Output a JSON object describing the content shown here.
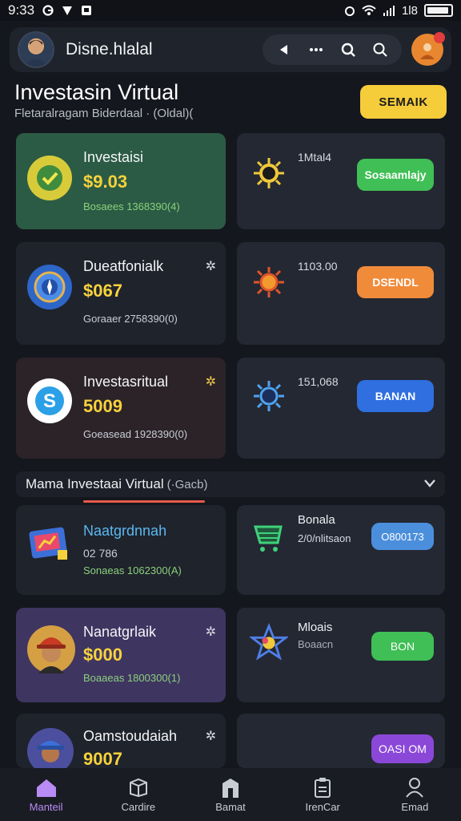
{
  "status": {
    "time": "9:33",
    "right_text": "1l8"
  },
  "appbar": {
    "title": "Disne.hlalal"
  },
  "page": {
    "title": "Investasin Virtual",
    "subtitle": "Fletaralragam Biderdaal · (Oldal)(",
    "button": "SEMAIK"
  },
  "cards": [
    {
      "title": "Investaisi",
      "value": "$9.03",
      "sub": "Bosaees 1368390(4)"
    },
    {
      "label": "1Mtal4",
      "button": "Sosaamlajy"
    },
    {
      "title": "Dueatfonialk",
      "value": "$067",
      "sub": "Goraaer 2758390(0)"
    },
    {
      "label": "1103.00",
      "button": "DSENDL"
    },
    {
      "title": "Investasritual",
      "value": "5009",
      "sub": "Goeasead 1928390(0)"
    },
    {
      "label": "151,068",
      "button": "BANAN"
    },
    {
      "title": "Naatgrdnnah",
      "value": "02 786",
      "sub": "Sonaeas 1062300(A)"
    },
    {
      "label": "Bonala",
      "label2": "2/0/nlitsaon",
      "button": "O800173"
    },
    {
      "title": "Nanatgrlaik",
      "value": "$000",
      "sub": "Boaaeas 1800300(1)"
    },
    {
      "label": "Mloais",
      "label2": "Boaacn",
      "button": "BON"
    },
    {
      "title": "Oamstoudaiah",
      "value": "9007",
      "sub": ""
    },
    {
      "label": "",
      "button": "OASI OM"
    }
  ],
  "section": {
    "label": "Mama Investaai Virtual",
    "hint": "(·Gacb)"
  },
  "nav": [
    {
      "label": "Manteil"
    },
    {
      "label": "Cardire"
    },
    {
      "label": "Bamat"
    },
    {
      "label": "IrenCar"
    },
    {
      "label": "Emad"
    }
  ],
  "colors": {
    "accent_yellow": "#f5cc3a",
    "active_nav": "#b98bf5",
    "green_btn": "#3fbf55",
    "orange_btn": "#f08b3a",
    "blue_btn": "#2f6fe0",
    "purple_btn": "#8b48d8"
  }
}
